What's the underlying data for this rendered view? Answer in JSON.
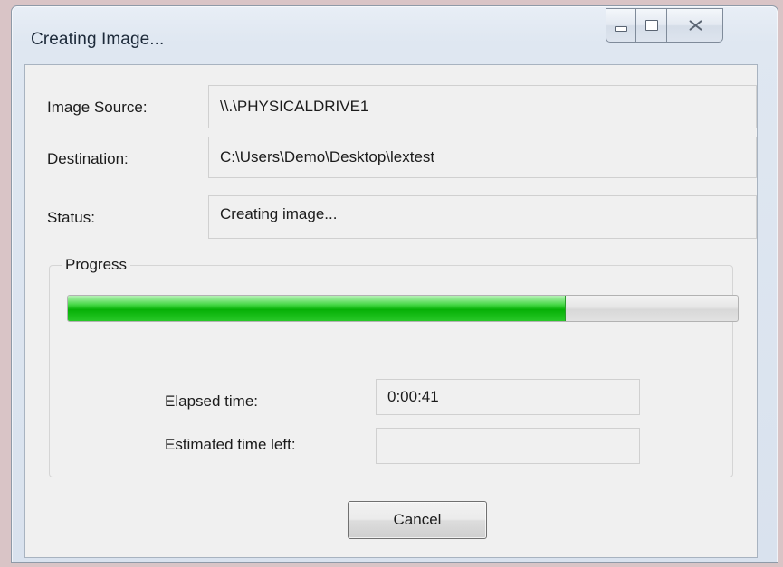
{
  "window": {
    "title": "Creating Image...",
    "caption_buttons": {
      "minimize_icon": "minimize-icon",
      "maximize_icon": "maximize-icon",
      "close_icon": "close-icon"
    }
  },
  "fields": {
    "image_source": {
      "label": "Image Source:",
      "value": "\\\\.\\PHYSICALDRIVE1"
    },
    "destination": {
      "label": "Destination:",
      "value": "C:\\Users\\Demo\\Desktop\\lextest"
    },
    "status": {
      "label": "Status:",
      "value": "Creating image..."
    }
  },
  "progress": {
    "label": "Progress",
    "fraction": 0.743,
    "fill_color": "#1fc01f",
    "elapsed_label": "Elapsed time:",
    "elapsed_value": "0:00:41",
    "remaining_label": "Estimated time left:",
    "remaining_value": ""
  },
  "actions": {
    "cancel_label": "Cancel"
  }
}
